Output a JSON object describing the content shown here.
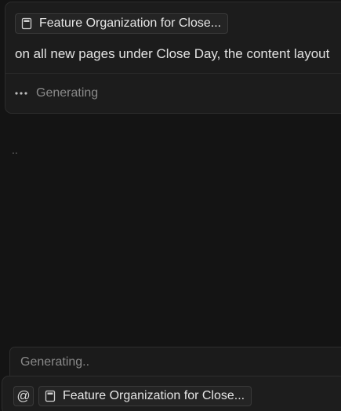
{
  "message": {
    "context_chip": {
      "icon": "page-icon",
      "label": "Feature Organization for Close..."
    },
    "text": "on all new pages under Close Day, the content layout",
    "status": {
      "icon": "ellipsis-icon",
      "label": "Generating"
    }
  },
  "stream_indicator": "..",
  "composer": {
    "placeholder": "Generating..",
    "mention_button": {
      "icon": "at-icon",
      "label": "@"
    },
    "context_chip": {
      "icon": "page-icon",
      "label": "Feature Organization for Close..."
    }
  }
}
